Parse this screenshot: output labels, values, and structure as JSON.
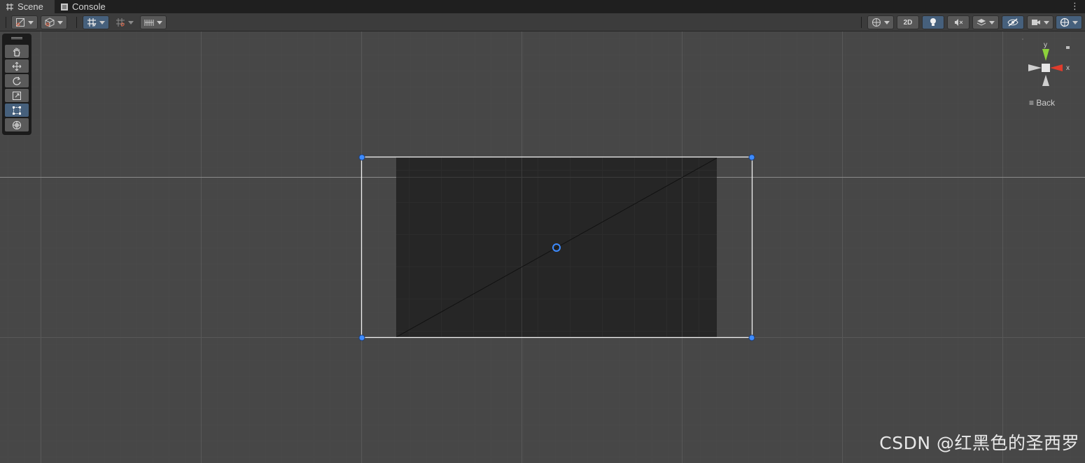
{
  "tabs": [
    {
      "label": "Scene",
      "icon": "grid-icon",
      "active": true
    },
    {
      "label": "Console",
      "icon": "console-icon",
      "active": false
    }
  ],
  "toolbar": {
    "mode_2d_label": "2D"
  },
  "gizmo": {
    "axis_y": "y",
    "axis_x": "x",
    "view_label": "Back"
  },
  "colors": {
    "accent": "#3d8bff",
    "selected_tool": "#46607c",
    "scene_bg": "#474747",
    "camera_rect": "#262626",
    "axis_x": "#e03c2c",
    "axis_y": "#8dd23b"
  },
  "watermark": "CSDN @红黑色的圣西罗"
}
